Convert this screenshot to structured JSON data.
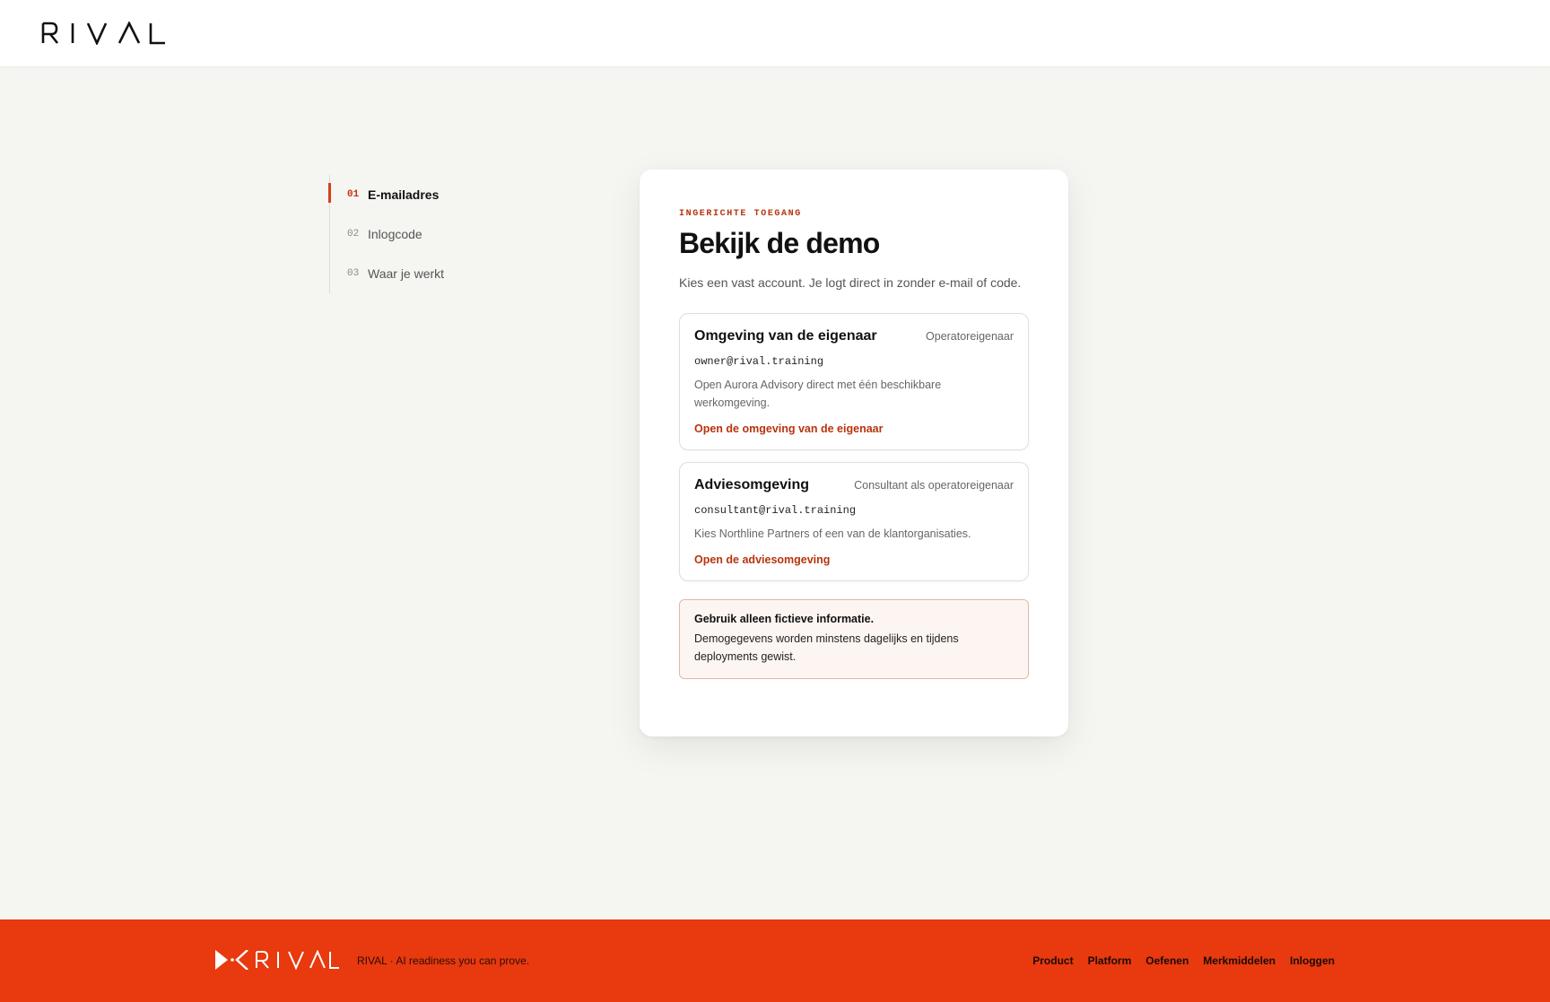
{
  "header": {
    "logo_text": "RIVAL"
  },
  "steps": [
    {
      "num": "01",
      "label": "E-mailadres",
      "active": true
    },
    {
      "num": "02",
      "label": "Inlogcode",
      "active": false
    },
    {
      "num": "03",
      "label": "Waar je werkt",
      "active": false
    }
  ],
  "card": {
    "eyebrow": "INGERICHTE TOEGANG",
    "title": "Bekijk de demo",
    "subtitle": "Kies een vast account. Je logt direct in zonder e-mail of code.",
    "accounts": [
      {
        "name": "Omgeving van de eigenaar",
        "role": "Operatoreigenaar",
        "email": "owner@rival.training",
        "description": "Open Aurora Advisory direct met één beschikbare werkomgeving.",
        "link": "Open de omgeving van de eigenaar"
      },
      {
        "name": "Adviesomgeving",
        "role": "Consultant als operatoreigenaar",
        "email": "consultant@rival.training",
        "description": "Kies Northline Partners of een van de klantorganisaties.",
        "link": "Open de adviesomgeving"
      }
    ],
    "notice": {
      "title": "Gebruik alleen fictieve informatie.",
      "text": "Demogegevens worden minstens dagelijks en tijdens deployments gewist."
    }
  },
  "footer": {
    "logo_text": "RIVAL",
    "tagline": "RIVAL · AI readiness you can prove.",
    "nav": [
      "Product",
      "Platform",
      "Oefenen",
      "Merkmiddelen",
      "Inloggen"
    ]
  },
  "colors": {
    "accent": "#e8390f",
    "accent_text": "#b7340e",
    "background": "#f5f5f2"
  }
}
